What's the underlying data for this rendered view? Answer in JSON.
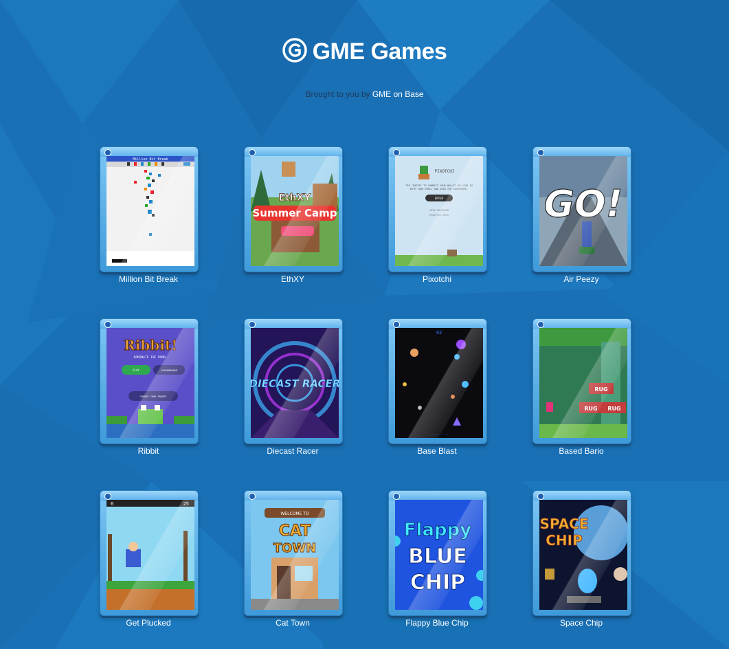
{
  "header": {
    "title": "GME Games",
    "byline_prefix": "Brought to you by",
    "byline_link": "GME on Base"
  },
  "colors": {
    "background": "#1a70b5",
    "case": "#5db0ea",
    "text": "#ffffff"
  },
  "games": [
    {
      "label": "Million Bit Break",
      "art_text": "Million Bit Break"
    },
    {
      "label": "EthXY",
      "art_text": "EthXY Summer Camp"
    },
    {
      "label": "Pixotchi",
      "art_text": "PIXOTCHI",
      "art_sub": "TAP \"ENTER\" TO CONNECT YOUR WALLET OR SIGN IN WITH YOUR EMAIL AND JOIN THE ADVENTURE.",
      "art_button": "ENTER"
    },
    {
      "label": "Air Peezy",
      "art_text": "GO!"
    },
    {
      "label": "Ribbit",
      "art_text": "Ribbit!",
      "art_sub": "DOMINATE THE POND.",
      "art_button": "PLAY",
      "art_button2": "LEADERBOARD",
      "art_button3": "CHOOSE YOUR FROGGY"
    },
    {
      "label": "Diecast Racer",
      "art_text": "DIECAST RACER"
    },
    {
      "label": "Base Blast",
      "art_text": "92"
    },
    {
      "label": "Based Bario",
      "art_text": "RUG"
    },
    {
      "label": "Get Plucked",
      "art_text": "25"
    },
    {
      "label": "Cat Town",
      "art_text": "WELCOME TO",
      "art_sub": "CAT TOWN"
    },
    {
      "label": "Flappy Blue Chip",
      "art_text": "Flappy",
      "art_sub": "BLUE CHIP"
    },
    {
      "label": "Space Chip",
      "art_text": "SPACE",
      "art_sub": "CHIP"
    }
  ]
}
